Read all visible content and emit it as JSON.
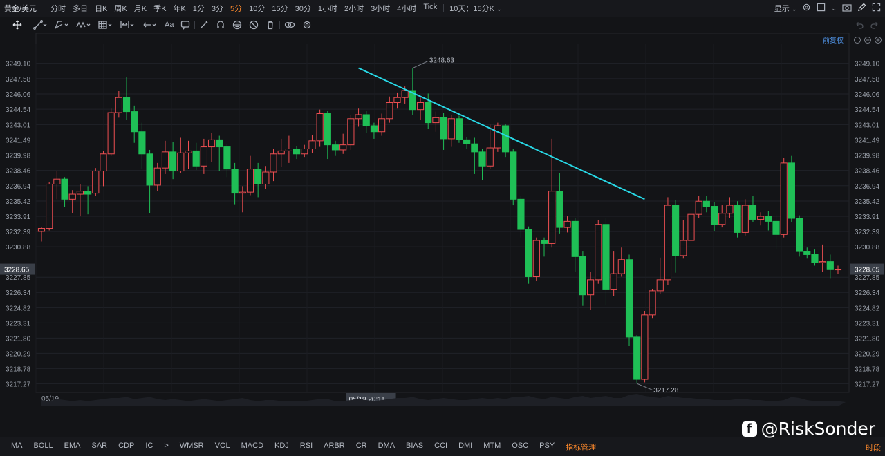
{
  "topbar": {
    "symbol": "黄金/美元",
    "periods": [
      "分时",
      "多日",
      "日K",
      "周K",
      "月K",
      "季K",
      "年K",
      "1分",
      "3分",
      "5分",
      "10分",
      "15分",
      "30分",
      "1小时",
      "2小时",
      "3小时",
      "4小时",
      "Tick"
    ],
    "active_period": "5分",
    "range_select": "10天：15分K",
    "display_label": "显示"
  },
  "toolbar": {
    "text_tool": "Aa",
    "adjust_label": "前复权"
  },
  "colors": {
    "up": "#ef4f52",
    "down": "#1fbf56",
    "trendline": "#28d8e6",
    "price_line": "#e0703a",
    "grid": "#202228"
  },
  "chart_data": {
    "type": "candlestick",
    "y_ticks": [
      "3249.10",
      "3247.58",
      "3246.06",
      "3244.54",
      "3243.01",
      "3241.49",
      "3239.98",
      "3238.46",
      "3236.94",
      "3235.42",
      "3233.91",
      "3232.39",
      "3230.88",
      "3227.85",
      "3226.34",
      "3224.82",
      "3223.31",
      "3221.80",
      "3220.29",
      "3218.78",
      "3217.27"
    ],
    "ylim": [
      3216.4,
      3251.0
    ],
    "current_price": "3228.65",
    "high_annotation": "3248.63",
    "low_annotation": "3217.28",
    "date_label": "05/19",
    "crosshair_label": "05/19 20:11",
    "trendline": {
      "from": [
        41,
        3248.63
      ],
      "to": [
        78,
        3235.6
      ]
    },
    "candles": [
      [
        3232.4,
        3232.7,
        3231.4,
        3232.8
      ],
      [
        3232.7,
        3237.1,
        3232.5,
        3237.3
      ],
      [
        3237.1,
        3237.6,
        3235.6,
        3238.4
      ],
      [
        3237.6,
        3235.6,
        3234.8,
        3237.8
      ],
      [
        3235.6,
        3236.1,
        3234.2,
        3236.5
      ],
      [
        3236.1,
        3236.4,
        3233.9,
        3237.1
      ],
      [
        3236.4,
        3236.1,
        3234.1,
        3236.9
      ],
      [
        3236.2,
        3238.4,
        3235.9,
        3238.7
      ],
      [
        3238.4,
        3240.1,
        3236.9,
        3240.4
      ],
      [
        3240.1,
        3244.2,
        3239.9,
        3244.6
      ],
      [
        3244.2,
        3245.7,
        3243.7,
        3246.4
      ],
      [
        3245.7,
        3244.3,
        3243.5,
        3247.7
      ],
      [
        3244.3,
        3242.3,
        3241.2,
        3244.9
      ],
      [
        3242.3,
        3240.1,
        3238.6,
        3243.2
      ],
      [
        3240.1,
        3237.0,
        3234.2,
        3240.5
      ],
      [
        3237.0,
        3238.7,
        3236.4,
        3239.2
      ],
      [
        3238.7,
        3240.3,
        3238.1,
        3241.4
      ],
      [
        3240.3,
        3238.4,
        3237.6,
        3241.3
      ],
      [
        3238.4,
        3240.2,
        3238.2,
        3241.7
      ],
      [
        3240.2,
        3240.4,
        3238.6,
        3241.4
      ],
      [
        3240.4,
        3238.9,
        3238.5,
        3241.2
      ],
      [
        3238.9,
        3240.8,
        3238.1,
        3241.6
      ],
      [
        3240.8,
        3241.5,
        3239.3,
        3242.2
      ],
      [
        3241.5,
        3240.8,
        3238.4,
        3241.9
      ],
      [
        3240.8,
        3238.6,
        3237.8,
        3241.1
      ],
      [
        3238.6,
        3236.2,
        3235.1,
        3239.2
      ],
      [
        3236.2,
        3236.3,
        3234.3,
        3236.9
      ],
      [
        3236.3,
        3238.6,
        3236.0,
        3239.9
      ],
      [
        3238.6,
        3237.1,
        3235.8,
        3239.2
      ],
      [
        3237.1,
        3238.3,
        3236.6,
        3238.9
      ],
      [
        3238.3,
        3240.1,
        3237.4,
        3240.6
      ],
      [
        3240.1,
        3240.4,
        3238.8,
        3241.6
      ],
      [
        3240.4,
        3240.6,
        3239.2,
        3241.9
      ],
      [
        3240.6,
        3240.1,
        3239.6,
        3240.9
      ],
      [
        3240.1,
        3240.6,
        3239.8,
        3241.0
      ],
      [
        3240.6,
        3241.4,
        3240.2,
        3242.0
      ],
      [
        3241.4,
        3244.1,
        3240.8,
        3244.5
      ],
      [
        3244.1,
        3241.0,
        3239.6,
        3244.4
      ],
      [
        3241.0,
        3240.5,
        3239.9,
        3241.4
      ],
      [
        3240.5,
        3241.0,
        3240.1,
        3242.1
      ],
      [
        3241.0,
        3243.6,
        3240.5,
        3244.0
      ],
      [
        3243.6,
        3244.0,
        3242.8,
        3244.6
      ],
      [
        3244.0,
        3242.9,
        3242.2,
        3244.4
      ],
      [
        3242.9,
        3242.3,
        3241.6,
        3243.2
      ],
      [
        3242.3,
        3243.6,
        3241.9,
        3244.1
      ],
      [
        3243.6,
        3245.2,
        3243.2,
        3245.8
      ],
      [
        3245.2,
        3245.7,
        3244.6,
        3246.2
      ],
      [
        3245.7,
        3246.4,
        3245.1,
        3246.8
      ],
      [
        3246.4,
        3244.5,
        3244.0,
        3248.63
      ],
      [
        3244.5,
        3245.2,
        3243.5,
        3245.7
      ],
      [
        3245.2,
        3243.2,
        3242.6,
        3246.1
      ],
      [
        3243.2,
        3243.7,
        3242.3,
        3244.3
      ],
      [
        3243.7,
        3241.6,
        3240.5,
        3244.2
      ],
      [
        3241.6,
        3243.6,
        3240.8,
        3244.0
      ],
      [
        3243.6,
        3241.5,
        3241.2,
        3243.9
      ],
      [
        3241.5,
        3241.1,
        3240.6,
        3241.8
      ],
      [
        3241.1,
        3240.3,
        3238.1,
        3241.7
      ],
      [
        3240.3,
        3238.9,
        3237.5,
        3240.6
      ],
      [
        3238.9,
        3240.7,
        3238.6,
        3243.0
      ],
      [
        3240.7,
        3242.9,
        3240.3,
        3243.2
      ],
      [
        3242.9,
        3240.3,
        3239.8,
        3243.1
      ],
      [
        3240.3,
        3235.6,
        3235.0,
        3240.6
      ],
      [
        3235.6,
        3232.6,
        3231.8,
        3235.9
      ],
      [
        3232.6,
        3227.9,
        3227.2,
        3232.9
      ],
      [
        3227.9,
        3231.5,
        3227.5,
        3231.8
      ],
      [
        3231.5,
        3231.2,
        3229.9,
        3231.8
      ],
      [
        3231.2,
        3236.4,
        3230.8,
        3241.6
      ],
      [
        3236.4,
        3232.8,
        3232.2,
        3238.2
      ],
      [
        3232.8,
        3233.4,
        3232.3,
        3233.9
      ],
      [
        3233.4,
        3229.9,
        3228.4,
        3233.7
      ],
      [
        3229.9,
        3226.1,
        3225.0,
        3230.4
      ],
      [
        3226.1,
        3227.6,
        3224.6,
        3228.4
      ],
      [
        3227.6,
        3233.1,
        3227.2,
        3233.5
      ],
      [
        3233.1,
        3226.6,
        3225.1,
        3233.7
      ],
      [
        3226.6,
        3228.2,
        3226.0,
        3230.4
      ],
      [
        3228.2,
        3229.6,
        3227.9,
        3230.8
      ],
      [
        3229.6,
        3221.9,
        3221.0,
        3230.1
      ],
      [
        3221.9,
        3217.7,
        3217.28,
        3222.1
      ],
      [
        3217.7,
        3224.1,
        3217.4,
        3224.5
      ],
      [
        3224.1,
        3226.5,
        3223.8,
        3226.7
      ],
      [
        3226.5,
        3227.6,
        3226.2,
        3229.8
      ],
      [
        3227.6,
        3235.0,
        3227.1,
        3235.8
      ],
      [
        3235.0,
        3230.0,
        3228.3,
        3235.5
      ],
      [
        3230.0,
        3231.5,
        3229.7,
        3233.5
      ],
      [
        3231.5,
        3234.1,
        3231.0,
        3235.1
      ],
      [
        3234.1,
        3235.4,
        3233.7,
        3235.9
      ],
      [
        3235.4,
        3234.9,
        3234.3,
        3235.9
      ],
      [
        3234.9,
        3233.1,
        3232.4,
        3235.3
      ],
      [
        3233.1,
        3234.2,
        3232.8,
        3235.0
      ],
      [
        3234.2,
        3235.0,
        3233.7,
        3235.8
      ],
      [
        3235.0,
        3232.3,
        3231.8,
        3235.4
      ],
      [
        3232.3,
        3235.0,
        3232.0,
        3235.6
      ],
      [
        3235.0,
        3233.6,
        3233.3,
        3235.9
      ],
      [
        3233.6,
        3233.9,
        3233.0,
        3234.3
      ],
      [
        3233.9,
        3233.4,
        3232.5,
        3234.4
      ],
      [
        3233.4,
        3232.1,
        3230.6,
        3234.0
      ],
      [
        3232.1,
        3239.2,
        3231.8,
        3239.7
      ],
      [
        3239.2,
        3233.7,
        3233.3,
        3239.9
      ],
      [
        3233.7,
        3230.4,
        3229.9,
        3234.0
      ],
      [
        3230.4,
        3230.1,
        3229.7,
        3230.8
      ],
      [
        3230.1,
        3229.3,
        3229.0,
        3230.6
      ],
      [
        3229.3,
        3229.4,
        3228.4,
        3231.1
      ],
      [
        3229.4,
        3228.6,
        3227.7,
        3230.1
      ],
      [
        3228.6,
        3228.65,
        3228.2,
        3229.0
      ]
    ],
    "volume": [
      6,
      5,
      7,
      6,
      5,
      6,
      5,
      6,
      7,
      8,
      8,
      9,
      7,
      8,
      9,
      7,
      6,
      7,
      6,
      5,
      6,
      7,
      6,
      5,
      6,
      7,
      8,
      6,
      5,
      6,
      6,
      5,
      5,
      5,
      5,
      6,
      7,
      7,
      5,
      5,
      6,
      7,
      6,
      5,
      6,
      7,
      8,
      8,
      9,
      7,
      6,
      7,
      8,
      7,
      6,
      6,
      7,
      8,
      7,
      8,
      7,
      9,
      9,
      10,
      8,
      7,
      9,
      8,
      7,
      9,
      10,
      8,
      9,
      10,
      8,
      8,
      11,
      12,
      10,
      9,
      8,
      10,
      9,
      8,
      8,
      7,
      7,
      6,
      6,
      6,
      7,
      7,
      6,
      6,
      5,
      5,
      6,
      9,
      8,
      6,
      5,
      5,
      5,
      5,
      4
    ]
  },
  "indicators": [
    "MA",
    "BOLL",
    "EMA",
    "SAR",
    "CDP",
    "IC",
    "WMSR",
    "VOL",
    "MACD",
    "KDJ",
    "RSI",
    "ARBR",
    "CR",
    "DMA",
    "BIAS",
    "CCI",
    "DMI",
    "MTM",
    "OSC",
    "PSY"
  ],
  "indicator_manager": "指标管理",
  "corner_tag": "时段",
  "watermark": "@RiskSonder"
}
